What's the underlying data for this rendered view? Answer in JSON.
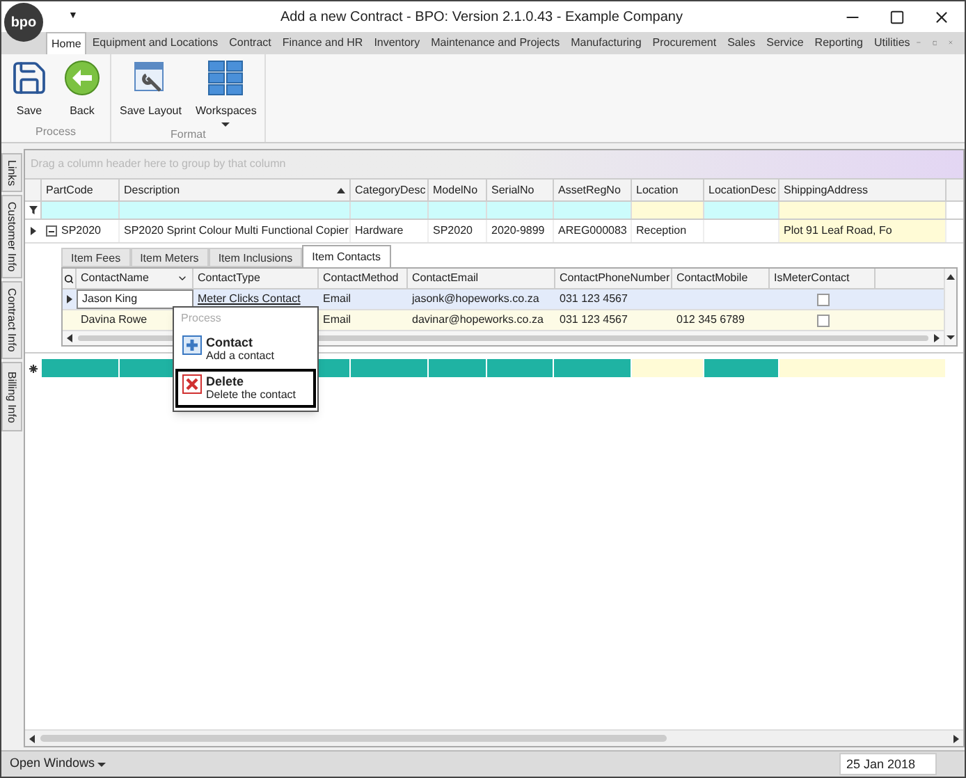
{
  "window": {
    "title": "Add a new Contract - BPO: Version 2.1.0.43 - Example Company",
    "logo": "bpo",
    "quick_access": "▼"
  },
  "ribbon": {
    "tabs": [
      {
        "label": "Home",
        "selected": true
      },
      {
        "label": "Equipment and Locations",
        "selected": false
      },
      {
        "label": "Contract",
        "selected": false
      },
      {
        "label": "Finance and HR",
        "selected": false
      },
      {
        "label": "Inventory",
        "selected": false
      },
      {
        "label": "Maintenance and Projects",
        "selected": false
      },
      {
        "label": "Manufacturing",
        "selected": false
      },
      {
        "label": "Procurement",
        "selected": false
      },
      {
        "label": "Sales",
        "selected": false
      },
      {
        "label": "Service",
        "selected": false
      },
      {
        "label": "Reporting",
        "selected": false
      },
      {
        "label": "Utilities",
        "selected": false
      }
    ],
    "groups": [
      {
        "label": "Process",
        "buttons": [
          {
            "label": "Save",
            "kind": "save",
            "dropdown": false
          },
          {
            "label": "Back",
            "kind": "back",
            "dropdown": false
          }
        ]
      },
      {
        "label": "Format",
        "buttons": [
          {
            "label": "Save Layout",
            "kind": "layout",
            "dropdown": false
          },
          {
            "label": "Workspaces",
            "kind": "workspaces",
            "dropdown": true
          }
        ]
      }
    ]
  },
  "side_tabs": [
    "Links",
    "Customer Info",
    "Contract Info",
    "Billing Info"
  ],
  "grid": {
    "group_panel": "Drag a column header here to group by that column",
    "columns": [
      {
        "label": "PartCode",
        "highlighted": false,
        "sorted": false
      },
      {
        "label": "Description",
        "highlighted": false,
        "sorted": true
      },
      {
        "label": "CategoryDesc",
        "highlighted": false,
        "sorted": false
      },
      {
        "label": "ModelNo",
        "highlighted": false,
        "sorted": false
      },
      {
        "label": "SerialNo",
        "highlighted": false,
        "sorted": false
      },
      {
        "label": "AssetRegNo",
        "highlighted": false,
        "sorted": false
      },
      {
        "label": "Location",
        "highlighted": true,
        "sorted": false
      },
      {
        "label": "LocationDesc",
        "highlighted": false,
        "sorted": false
      },
      {
        "label": "ShippingAddress",
        "highlighted": true,
        "sorted": false
      }
    ],
    "rows": [
      {
        "expanded": true,
        "cells": [
          "SP2020",
          "SP2020 Sprint Colour Multi Functional Copier",
          "Hardware",
          "SP2020",
          "2020-9899",
          "AREG000083",
          "Reception",
          null,
          "Plot 91 Leaf Road, Fo"
        ]
      }
    ],
    "detail": {
      "tabs": [
        {
          "label": "Item Fees",
          "selected": false
        },
        {
          "label": "Item Meters",
          "selected": false
        },
        {
          "label": "Item Inclusions",
          "selected": false
        },
        {
          "label": "Item Contacts",
          "selected": true
        }
      ],
      "columns": [
        "ContactName",
        "ContactType",
        "ContactMethod",
        "ContactEmail",
        "ContactPhoneNumber",
        "ContactMobile",
        "IsMeterContact"
      ],
      "rows": [
        {
          "selected": true,
          "is_meter_contact": false,
          "cells": [
            "Jason King",
            "Meter Clicks Contact",
            "Email",
            "jasonk@hopeworks.co.za",
            "031 123 4567",
            null
          ]
        },
        {
          "selected": false,
          "is_meter_contact": false,
          "cells": [
            "Davina Rowe",
            null,
            "Email",
            "davinar@hopeworks.co.za",
            "031 123 4567",
            "012 345 6789"
          ]
        }
      ]
    }
  },
  "context_menu": {
    "title": "Process",
    "items": [
      {
        "kind": "add",
        "label": "Contact",
        "description": "Add a contact",
        "selected": false
      },
      {
        "kind": "delete",
        "label": "Delete",
        "description": "Delete the contact",
        "selected": true
      }
    ]
  },
  "status_bar": {
    "open_windows": "Open Windows",
    "date": "25 Jan 2018"
  }
}
